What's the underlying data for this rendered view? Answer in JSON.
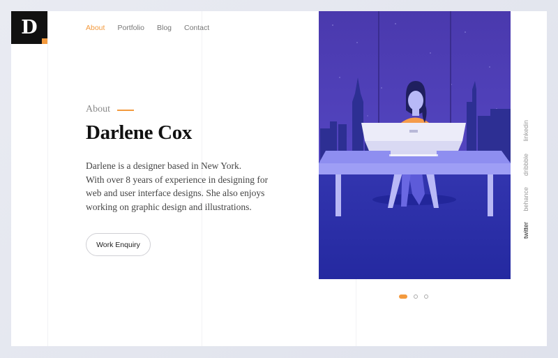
{
  "logo": {
    "letter": "D"
  },
  "nav": {
    "items": [
      {
        "label": "About",
        "active": true
      },
      {
        "label": "Portfolio",
        "active": false
      },
      {
        "label": "Blog",
        "active": false
      },
      {
        "label": "Contact",
        "active": false
      }
    ]
  },
  "hero": {
    "section_label": "About",
    "name": "Darlene Cox",
    "bio_lines": [
      "Darlene is a designer based in New York.",
      "With over 8 years of experience in designing for",
      "web and user interface designs. She also enjoys",
      "working on graphic design and illustrations."
    ],
    "cta_label": "Work Enquiry"
  },
  "carousel": {
    "slide_count": 3,
    "active_index": 0
  },
  "social": {
    "links": [
      {
        "label": "linkedin",
        "active": false
      },
      {
        "label": "dribbble",
        "active": false
      },
      {
        "label": "behance",
        "active": false
      },
      {
        "label": "twitter",
        "active": true
      }
    ]
  },
  "colors": {
    "accent": "#f39a3e",
    "illustration_sky": "#4b3fb8",
    "illustration_floor": "#2b2f9c"
  }
}
